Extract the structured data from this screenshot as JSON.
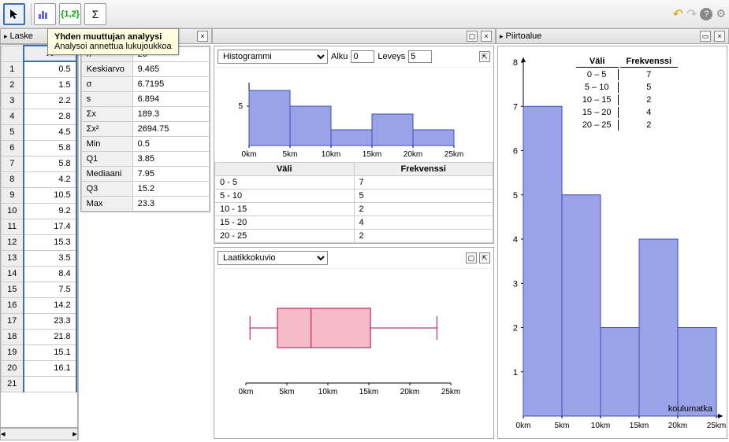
{
  "tooltip": {
    "title": "Yhden muuttujan analyysi",
    "desc": "Analysoi annettua lukujoukkoa"
  },
  "tabs": {
    "spreadsheet": "Laske",
    "graphics": "Piirtoalue"
  },
  "colHeader": "A",
  "rows": [
    0.5,
    1.5,
    2.2,
    2.8,
    4.5,
    5.8,
    5.8,
    4.2,
    10.5,
    9.2,
    17.4,
    15.3,
    3.5,
    8.4,
    7.5,
    14.2,
    23.3,
    21.8,
    15.1,
    16.1
  ],
  "stats": [
    {
      "k": "n",
      "v": "20"
    },
    {
      "k": "Keskiarvo",
      "v": "9.465"
    },
    {
      "k": "σ",
      "v": "6.7195"
    },
    {
      "k": "s",
      "v": "6.894"
    },
    {
      "k": "Σx",
      "v": "189.3"
    },
    {
      "k": "Σx²",
      "v": "2694.75"
    },
    {
      "k": "Min",
      "v": "0.5"
    },
    {
      "k": "Q1",
      "v": "3.85"
    },
    {
      "k": "Mediaani",
      "v": "7.95"
    },
    {
      "k": "Q3",
      "v": "15.2"
    },
    {
      "k": "Max",
      "v": "23.3"
    }
  ],
  "histo": {
    "dropdown": "Histogrammi",
    "alkuLbl": "Alku",
    "alkuVal": "0",
    "leveysLbl": "Leveys",
    "leveysVal": "5",
    "xticks": [
      "0km",
      "5km",
      "10km",
      "15km",
      "20km",
      "25km"
    ],
    "yticks": [
      "5"
    ]
  },
  "freqTable": {
    "h1": "Väli",
    "h2": "Frekvenssi",
    "rows": [
      [
        "0 - 5",
        "7"
      ],
      [
        "5 - 10",
        "5"
      ],
      [
        "10 - 15",
        "2"
      ],
      [
        "15 - 20",
        "4"
      ],
      [
        "20 - 25",
        "2"
      ]
    ]
  },
  "boxplot": {
    "dropdown": "Laatikkokuvio",
    "xticks": [
      "0km",
      "5km",
      "10km",
      "15km",
      "20km",
      "25km"
    ]
  },
  "rightPlot": {
    "xlabel": "koulumatka",
    "xticks": [
      "0km",
      "5km",
      "10km",
      "15km",
      "20km",
      "25km"
    ],
    "yticks": [
      "1",
      "2",
      "3",
      "4",
      "5",
      "6",
      "7",
      "8"
    ],
    "table": {
      "h1": "Väli",
      "h2": "Frekvenssi",
      "rows": [
        [
          "0 – 5",
          "7"
        ],
        [
          "5 – 10",
          "5"
        ],
        [
          "10 – 15",
          "2"
        ],
        [
          "15 – 20",
          "4"
        ],
        [
          "20 – 25",
          "2"
        ]
      ]
    }
  },
  "chart_data": [
    {
      "type": "bar",
      "title": "Histogrammi",
      "xlabel": "km",
      "ylabel": "",
      "categories": [
        "0-5",
        "5-10",
        "10-15",
        "15-20",
        "20-25"
      ],
      "values": [
        7,
        5,
        2,
        4,
        2
      ],
      "ylim": [
        0,
        8
      ]
    },
    {
      "type": "boxplot",
      "min": 0.5,
      "q1": 3.85,
      "median": 7.95,
      "q3": 15.2,
      "max": 23.3,
      "xlim": [
        0,
        25
      ]
    },
    {
      "type": "bar",
      "title": "koulumatka",
      "xlabel": "km",
      "ylabel": "",
      "categories": [
        "0-5",
        "5-10",
        "10-15",
        "15-20",
        "20-25"
      ],
      "values": [
        7,
        5,
        2,
        4,
        2
      ],
      "ylim": [
        0,
        8
      ]
    }
  ]
}
